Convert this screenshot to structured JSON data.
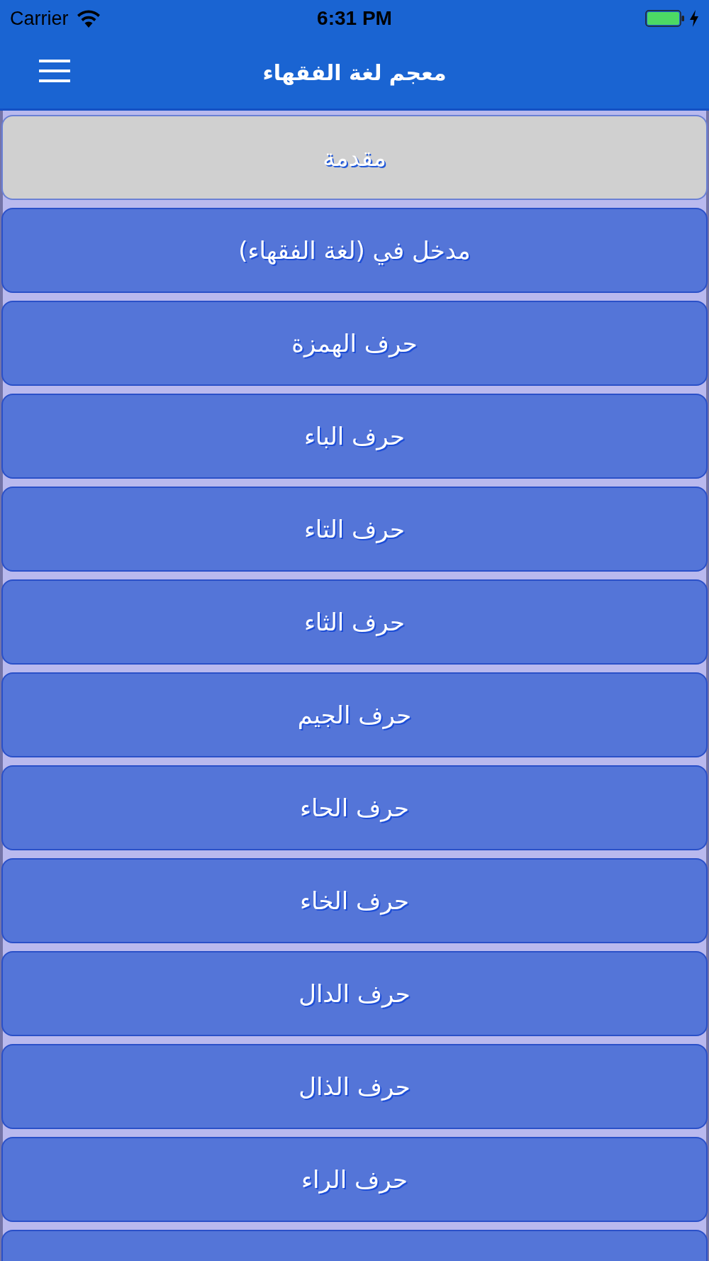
{
  "status_bar": {
    "carrier": "Carrier",
    "time": "6:31 PM"
  },
  "nav_bar": {
    "title": "معجم لغة الفقهاء"
  },
  "items": [
    {
      "label": "مقدمة",
      "selected": true
    },
    {
      "label": "مدخل في (لغة الفقهاء)",
      "selected": false
    },
    {
      "label": "حرف الهمزة",
      "selected": false
    },
    {
      "label": "حرف الباء",
      "selected": false
    },
    {
      "label": "حرف التاء",
      "selected": false
    },
    {
      "label": "حرف الثاء",
      "selected": false
    },
    {
      "label": "حرف الجيم",
      "selected": false
    },
    {
      "label": "حرف الحاء",
      "selected": false
    },
    {
      "label": "حرف الخاء",
      "selected": false
    },
    {
      "label": "حرف الدال",
      "selected": false
    },
    {
      "label": "حرف الذال",
      "selected": false
    },
    {
      "label": "حرف الراء",
      "selected": false
    },
    {
      "selected": false
    }
  ]
}
